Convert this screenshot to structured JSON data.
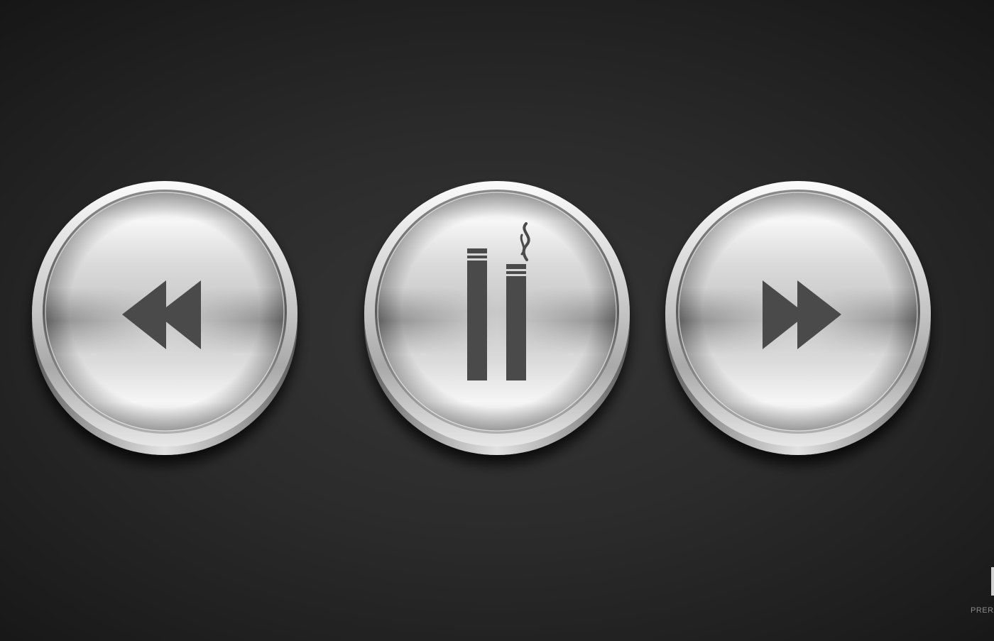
{
  "controls": {
    "rewind": {
      "icon": "rewind-icon"
    },
    "pause": {
      "icon": "smoking-cigarettes-pause-icon"
    },
    "forward": {
      "icon": "fast-forward-icon"
    }
  },
  "colors": {
    "background": "#2b2b2b",
    "icon": "#4a4a4a",
    "metal_light": "#f5f5f5",
    "metal_dark": "#6e6e6e"
  },
  "watermark": {
    "text": "PRERA"
  }
}
